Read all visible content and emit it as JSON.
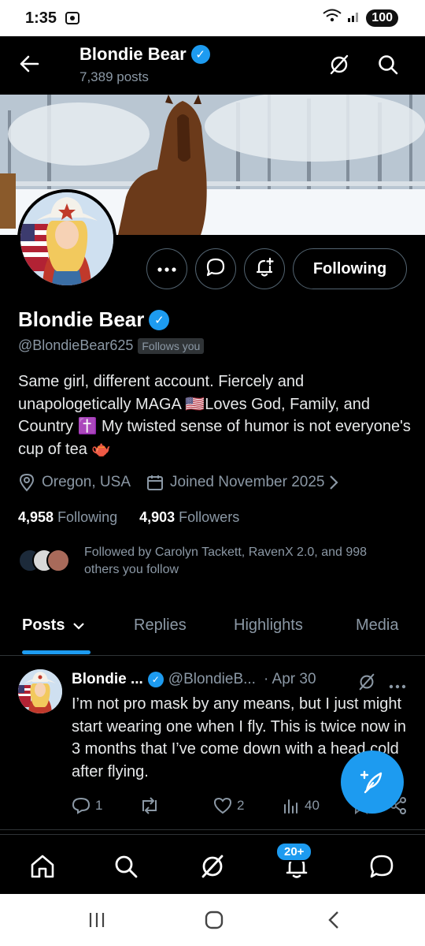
{
  "status_bar": {
    "time": "1:35",
    "battery": "100"
  },
  "header": {
    "title": "Blondie Bear",
    "posts_count": "7,389 posts"
  },
  "profile": {
    "name": "Blondie Bear",
    "handle": "@BlondieBear625",
    "follows_you": "Follows you",
    "bio": "Same girl, different account. Fiercely and unapologetically MAGA 🇺🇸Loves God, Family, and Country ✝️ My twisted sense of humor is not everyone's cup of tea 🫖",
    "location": "Oregon, USA",
    "joined": "Joined November 2025",
    "following_count": "4,958",
    "following_label": "Following",
    "followers_count": "4,903",
    "followers_label": "Followers",
    "followed_by": "Followed by Carolyn Tackett, RavenX 2.0, and 998 others you follow",
    "following_button": "Following"
  },
  "tabs": [
    {
      "label": "Posts"
    },
    {
      "label": "Replies"
    },
    {
      "label": "Highlights"
    },
    {
      "label": "Media"
    }
  ],
  "post": {
    "name": "Blondie ...",
    "handle": "@BlondieB...",
    "date": "· Apr 30",
    "text": "I’m not pro mask by any means, but I just might start wearing one when I fly. This is twice now in 3 months that I’ve come down with a head cold after flying.",
    "replies": "1",
    "likes": "2",
    "views": "40"
  },
  "bottom_nav": {
    "notification_badge": "20+"
  },
  "colors": {
    "accent": "#1d9bf0",
    "background": "#000000",
    "muted": "#8b98a5"
  }
}
